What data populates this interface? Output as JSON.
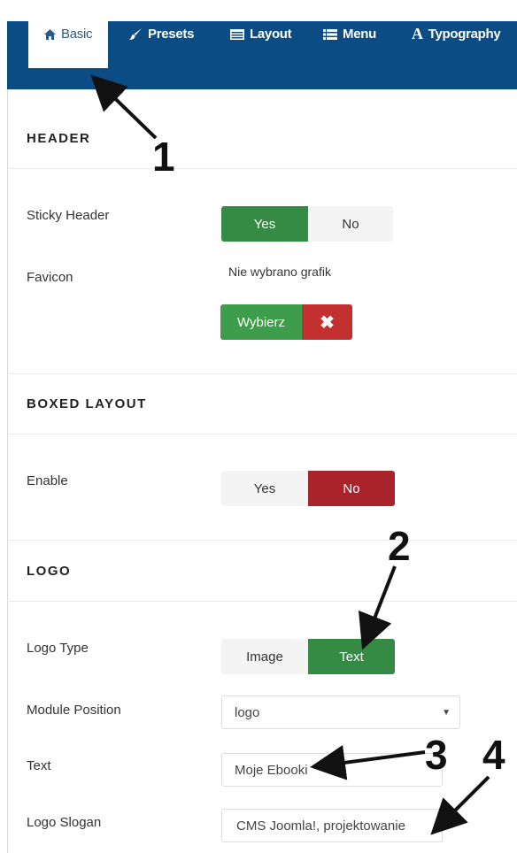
{
  "tabs": [
    {
      "label": "Basic",
      "icon": "home-icon",
      "active": true
    },
    {
      "label": "Presets",
      "icon": "brush-icon"
    },
    {
      "label": "Layout",
      "icon": "layout-icon"
    },
    {
      "label": "Menu",
      "icon": "menu-icon"
    },
    {
      "label": "Typography",
      "icon": "typography-icon"
    }
  ],
  "header_section": {
    "title": "HEADER",
    "sticky_label": "Sticky Header",
    "sticky_yes": "Yes",
    "sticky_no": "No",
    "favicon_label": "Favicon",
    "favicon_status": "Nie wybrano grafik",
    "select_button": "Wybierz",
    "clear_button": "✖"
  },
  "boxed_section": {
    "title": "BOXED LAYOUT",
    "enable_label": "Enable",
    "yes": "Yes",
    "no": "No"
  },
  "logo_section": {
    "title": "LOGO",
    "type_label": "Logo Type",
    "type_image": "Image",
    "type_text": "Text",
    "position_label": "Module Position",
    "position_value": "logo",
    "text_label": "Text",
    "text_value": "Moje Ebooki",
    "slogan_label": "Logo Slogan",
    "slogan_value": "CMS Joomla!, projektowanie"
  },
  "annotations": [
    "1",
    "2",
    "3",
    "4"
  ],
  "colors": {
    "tabbar": "#0c4c84",
    "green": "#358b43",
    "red": "#a8242a"
  }
}
